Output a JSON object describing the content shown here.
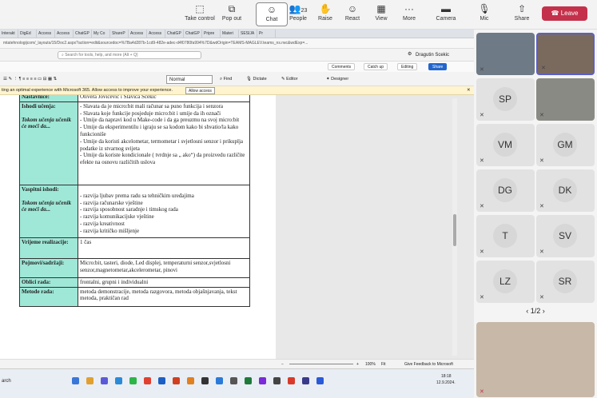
{
  "teams_bar": {
    "buttons": [
      {
        "label": "Take control",
        "icon": "pointer-icon"
      },
      {
        "label": "Pop out",
        "icon": "popout-icon"
      },
      {
        "label": "Chat",
        "icon": "chat-icon"
      },
      {
        "label": "People",
        "icon": "people-icon",
        "count": "23"
      },
      {
        "label": "Raise",
        "icon": "hand-icon"
      },
      {
        "label": "React",
        "icon": "smiley-icon"
      },
      {
        "label": "View",
        "icon": "view-icon"
      },
      {
        "label": "More",
        "icon": "more-icon"
      },
      {
        "label": "Camera",
        "icon": "camera-icon"
      },
      {
        "label": "Mic",
        "icon": "mic-icon"
      },
      {
        "label": "Share",
        "icon": "share-icon"
      }
    ],
    "leave_label": "Leave",
    "leave_color": "#c4314b"
  },
  "browser": {
    "tabs": [
      "Interakt",
      "DigEd",
      "Access",
      "Access",
      "ChatGP",
      "My Co",
      "ShareP",
      "Access",
      "Access",
      "ChatGP",
      "ChatGP",
      "Pripre",
      "Materi",
      "SESIJA",
      "Pr"
    ],
    "address": "mtatehnologijcom/_layouts/15/Doc2.aspx?action=edit&sourcedoc=%7Ba4d287b-1cd9-482e-adec-d4f0780fa994%7D&wdOrigin=TEAMS-MAGLEV.teams_ns.rwc&wdExp=..."
  },
  "office": {
    "search_placeholder": "Search for tools, help, and more (Alt + Q)",
    "user_name": "Dragutin Scekic",
    "ribbon_buttons": [
      "Comments",
      "Catch up",
      "Editing",
      "Share"
    ],
    "style_value": "Normal",
    "ribbon2_items": [
      "Find",
      "Dictate",
      "Editor",
      "Designer"
    ],
    "notice_text": "ting an optimal experience with Microsoft 365. Allow access to improve your experience.",
    "notice_button": "Allow access"
  },
  "document": {
    "rows": [
      {
        "label": "Nastavnice:",
        "content": [
          "Olivera Jovićević i Slavica Šćekić"
        ]
      },
      {
        "label": "Ishodi učenja:",
        "sublabel": "Tokom učenja učenik će moći da...",
        "content": [
          "- Slavata da je micro:bit mali računar sa puno funkcija i senzora",
          "- Slavata koje funkcije posjeduje micro:bit  i umije da ih označi",
          "- Umije da napravi kod u Make-code i da ga preuzmu na svoj micro:bit",
          "- Umije da eksperimentilu i igraju se sa kodom kako bi shvatio/la kako funkcioniše",
          "- Umije da koristi akcelometar, termometar i svjetlosni senzor  i prikuplja podatke iz stvarnog svijeta",
          "- Umije da koriste kondicionale ( tvrdnje sa „ ako“)  da proizvedu različite efekte na osnovu različitih uslova"
        ]
      },
      {
        "label": "Vaspitni ishodi:",
        "sublabel": "Tokom učenja učenik će moći da...",
        "content": [
          "- razvija ljubav prema radu sa tehničkim uređajima",
          "- razvija računarske vještine",
          "- razvija sposobnost saradnje i timskog rada",
          "- razvija komunikacijske vještine",
          "- razvija kreativnost",
          "- razvija kritičko mišljenje"
        ]
      },
      {
        "label": "Vrijeme realizacije:",
        "content": [
          "1 čas"
        ]
      },
      {
        "label": "Pojmovi/sadržaji:",
        "content": [
          "Micro:bit, tasteri, diode, Led  displej, temperaturni senzor,svjetlosni senzor,magnetometar,akcelerometar, pinovi"
        ]
      },
      {
        "label": "Oblici rada:",
        "content": [
          " frontalni, grupni i individualni"
        ]
      },
      {
        "label": "Metode rada:",
        "content": [
          "metoda demonstracije, metoda razgovora, metoda objašnjavanja, tekst metoda, praktičan rad"
        ]
      }
    ],
    "status_zoom": "100%",
    "status_fit": "Fit",
    "status_feedback": "Give Feedback to Microsoft"
  },
  "taskbar": {
    "search_label": "arch",
    "time": "18:18",
    "date": "12.9.2024."
  },
  "participants": {
    "tiles": [
      {
        "initials": "",
        "video": true
      },
      {
        "initials": "",
        "video": true
      },
      {
        "initials": "SP",
        "video": false
      },
      {
        "initials": "",
        "video": true
      },
      {
        "initials": "VM",
        "video": false
      },
      {
        "initials": "GM",
        "video": false
      },
      {
        "initials": "DG",
        "video": false
      },
      {
        "initials": "DK",
        "video": false
      },
      {
        "initials": "T",
        "video": false
      },
      {
        "initials": "SV",
        "video": false
      },
      {
        "initials": "LZ",
        "video": false
      },
      {
        "initials": "SR",
        "video": false
      }
    ],
    "pager": "1/2"
  }
}
